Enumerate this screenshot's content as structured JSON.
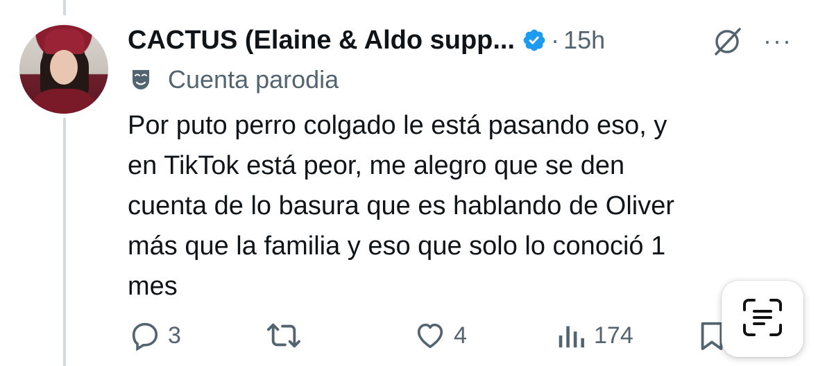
{
  "tweet": {
    "display_name": "CACTUS (Elaine & Aldo supp...",
    "separator": "·",
    "time": "15h",
    "more_label": "···",
    "parody_label": "Cuenta parodia",
    "text": "Por puto perro colgado le está pasando eso, y en TikTok está peor, me alegro que se den cuenta de lo basura que es hablando de Oliver más que la familia y eso que solo lo conoció 1 mes",
    "text_lines": [
      "Por puto perro colgado le está pasando eso, y",
      "en TikTok está peor, me alegro que se den",
      "cuenta de lo basura que es hablando de Oliver",
      "más que la familia y eso que solo lo conoció 1",
      "mes"
    ]
  },
  "actions": {
    "replies": "3",
    "retweets": "",
    "likes": "4",
    "views": "174"
  },
  "icons": {
    "verified": "verified-badge-icon",
    "grok": "grok-icon",
    "parody": "parody-mask-icon",
    "reply": "reply-icon",
    "retweet": "retweet-icon",
    "like": "heart-icon",
    "views": "views-icon",
    "bookmark": "bookmark-icon",
    "scan": "live-text-scan-icon"
  },
  "colors": {
    "text": "#0f1419",
    "secondary": "#536471",
    "verified_blue": "#1d9bf0",
    "thread_line": "#cfd9de"
  }
}
